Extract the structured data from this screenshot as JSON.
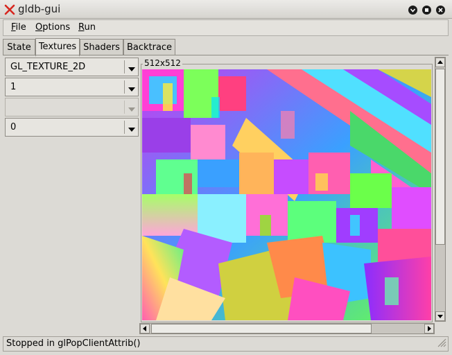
{
  "window": {
    "title": "gldb-gui"
  },
  "menu": [
    {
      "label": "File",
      "mnemonic": "F",
      "rest": "ile"
    },
    {
      "label": "Options",
      "mnemonic": "O",
      "rest": "ptions"
    },
    {
      "label": "Run",
      "mnemonic": "R",
      "rest": "un"
    }
  ],
  "tabs": [
    {
      "label": "State",
      "active": false
    },
    {
      "label": "Textures",
      "active": true
    },
    {
      "label": "Shaders",
      "active": false
    },
    {
      "label": "Backtrace",
      "active": false
    }
  ],
  "texture_panel": {
    "target_select": "GL_TEXTURE_2D",
    "texture_id_select": "1",
    "face_select": "",
    "level_select": "0",
    "size_label": "512x512"
  },
  "status": {
    "text": "Stopped in glPopClientAttrib()"
  },
  "colors": {
    "accent_close_x": "#d7261e",
    "window_bg": "#dcdad5"
  },
  "icons": {
    "app": "x-logo-icon",
    "minimize": "minimize-icon",
    "maximize": "maximize-icon",
    "close": "close-icon",
    "combo_arrow": "chevron-down-icon",
    "scroll_up": "arrow-up-icon",
    "scroll_down": "arrow-down-icon",
    "scroll_left": "arrow-left-icon",
    "scroll_right": "arrow-right-icon",
    "resize_grip": "resize-grip-icon"
  }
}
